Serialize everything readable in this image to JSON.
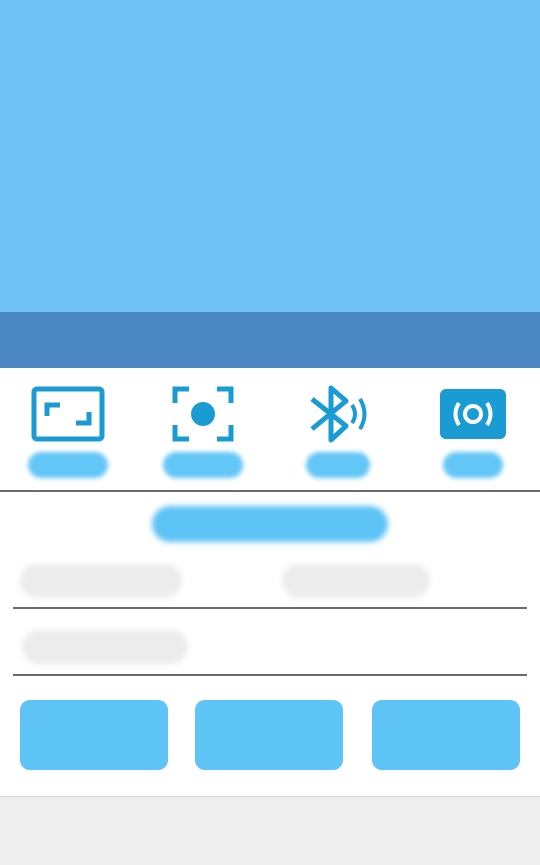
{
  "colors": {
    "accent": "#1a9bd3",
    "hero": "#6fc0f5",
    "hero_band": "#4a87c3",
    "button": "#5ec3f5",
    "divider": "#6b6b6b",
    "footer": "#efeff0"
  },
  "modes": [
    {
      "icon": "fullscreen-frame-icon",
      "label": ""
    },
    {
      "icon": "focus-record-icon",
      "label": ""
    },
    {
      "icon": "bluetooth-signal-icon",
      "label": ""
    },
    {
      "icon": "broadcast-icon",
      "label": ""
    }
  ],
  "info": {
    "title": "",
    "row1_left": "",
    "row1_right": "",
    "row2_left": ""
  },
  "actions": [
    {
      "label": ""
    },
    {
      "label": ""
    },
    {
      "label": ""
    }
  ]
}
